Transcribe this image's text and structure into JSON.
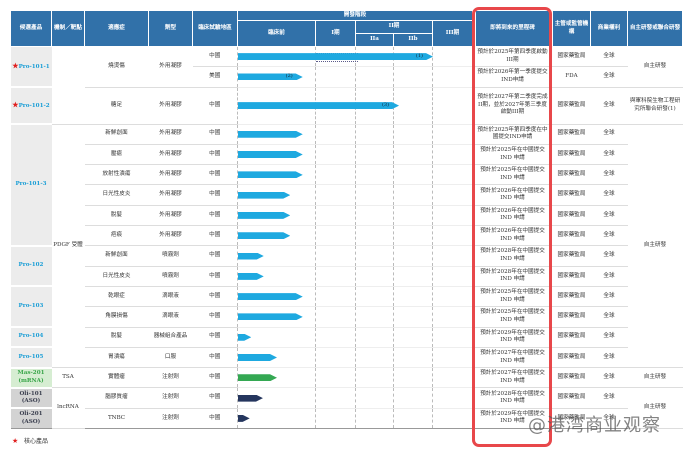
{
  "headers": {
    "drug": "候選產品",
    "mechanism": "機制／靶點",
    "indication": "適應症",
    "form": "劑型",
    "region": "臨床試驗地區",
    "stage": "開發階段",
    "preclinical": "臨床前",
    "phase1": "I期",
    "phase2": "II期",
    "phase2a": "IIa",
    "phase2b": "IIb",
    "phase3": "III期",
    "milestone": "即將到來的里程碑",
    "authority": "主管或監管機構",
    "rights": "商業權利",
    "dev_mode": "自主研發或聯合研發"
  },
  "colors": {
    "header": "#3171a9",
    "bar_blue": "#1ea9e0",
    "bar_green": "#34a853",
    "bar_navy": "#25365e",
    "highlight": "#e8474a",
    "star": "#e02020"
  },
  "stage_scale": [
    "臨床前",
    "I期",
    "IIa",
    "IIb",
    "III期"
  ],
  "drugs": [
    {
      "name": "Pro-101-1",
      "core": true,
      "rows": 2,
      "style": ""
    },
    {
      "name": "Pro-101-2",
      "core": true,
      "rows": 1,
      "style": ""
    },
    {
      "name": "Pro-101-3",
      "core": false,
      "rows": 6,
      "style": ""
    },
    {
      "name": "Pro-102",
      "core": false,
      "rows": 2,
      "style": ""
    },
    {
      "name": "Pro-103",
      "core": false,
      "rows": 2,
      "style": ""
    },
    {
      "name": "Pro-104",
      "core": false,
      "rows": 1,
      "style": ""
    },
    {
      "name": "Pro-105",
      "core": false,
      "rows": 1,
      "style": ""
    },
    {
      "name": "Mas-201 (mRNA)",
      "core": false,
      "rows": 1,
      "style": "green"
    },
    {
      "name": "Oli-101 (ASO)",
      "core": false,
      "rows": 1,
      "style": "gray"
    },
    {
      "name": "Oli-201 (ASO)",
      "core": false,
      "rows": 1,
      "style": "gray"
    }
  ],
  "mechanisms": [
    {
      "text": "",
      "rows": 3
    },
    {
      "text": "PDGF 受體",
      "rows": 12
    },
    {
      "text": "TSA",
      "rows": 1
    },
    {
      "text": "lncRNA",
      "rows": 2
    }
  ],
  "dev_modes": [
    {
      "text": "自主研發",
      "rows": 2
    },
    {
      "text": "與軍科院生物工程研究所聯合研發(1)",
      "rows": 1
    },
    {
      "text": "自主研發",
      "rows": 12
    },
    {
      "text": "自主研發",
      "rows": 1
    },
    {
      "text": "自主研發",
      "rows": 2
    }
  ],
  "indication_groups": [
    {
      "text": "燒燙傷",
      "rows": 2
    },
    {
      "text": "糖足",
      "rows": 1
    },
    {
      "text": "新鮮創面",
      "rows": 1
    },
    {
      "text": "壓瘡",
      "rows": 1
    },
    {
      "text": "放射性潰瘍",
      "rows": 1
    },
    {
      "text": "日光性皮炎",
      "rows": 1
    },
    {
      "text": "脫髮",
      "rows": 1
    },
    {
      "text": "疤痕",
      "rows": 1
    },
    {
      "text": "新鮮創面",
      "rows": 1
    },
    {
      "text": "日光性皮炎",
      "rows": 1
    },
    {
      "text": "乾眼症",
      "rows": 1
    },
    {
      "text": "角膜損傷",
      "rows": 1
    },
    {
      "text": "脫髮",
      "rows": 1
    },
    {
      "text": "胃潰瘍",
      "rows": 1
    },
    {
      "text": "實體瘤",
      "rows": 1
    },
    {
      "text": "腦膠質瘤",
      "rows": 1
    },
    {
      "text": "TNBC",
      "rows": 1
    }
  ],
  "form_groups": [
    {
      "text": "外用凝膠",
      "rows": 2
    },
    {
      "text": "外用凝膠",
      "rows": 1
    },
    {
      "text": "外用凝膠",
      "rows": 1
    },
    {
      "text": "外用凝膠",
      "rows": 1
    },
    {
      "text": "外用凝膠",
      "rows": 1
    },
    {
      "text": "外用凝膠",
      "rows": 1
    },
    {
      "text": "外用凝膠",
      "rows": 1
    },
    {
      "text": "外用凝膠",
      "rows": 1
    },
    {
      "text": "噴霧劑",
      "rows": 1
    },
    {
      "text": "噴霧劑",
      "rows": 1
    },
    {
      "text": "滴眼液",
      "rows": 1
    },
    {
      "text": "滴眼液",
      "rows": 1
    },
    {
      "text": "器械組合產品",
      "rows": 1
    },
    {
      "text": "口服",
      "rows": 1
    },
    {
      "text": "注射劑",
      "rows": 1
    },
    {
      "text": "注射劑",
      "rows": 1
    },
    {
      "text": "注射劑",
      "rows": 1
    }
  ],
  "rows": [
    {
      "region": "中國",
      "stage_reached": 4.0,
      "bar_label": "(1)",
      "color": "blue",
      "phase1_pending": true,
      "milestone": "預計於2025年第四季度啟動III期",
      "authority": "國家藥監局",
      "rights": "全球"
    },
    {
      "region": "美國",
      "stage_reached": 0.83,
      "bar_label": "(2)",
      "color": "blue",
      "milestone": "預計於2026年第一季度提交IND申請",
      "authority": "FDA",
      "rights": "全球"
    },
    {
      "region": "中國",
      "stage_reached": 3.13,
      "bar_label": "(3)",
      "color": "blue",
      "milestone": "預計於2027年第二季度完成II期，並於2027年第三季度啟動III期",
      "authority": "國家藥監局",
      "rights": "全球"
    },
    {
      "region": "中國",
      "stage_reached": 0.83,
      "bar_label": "",
      "color": "blue",
      "milestone": "預計於2025年第四季度在中國提交IND申請",
      "authority": "國家藥監局",
      "rights": "全球"
    },
    {
      "region": "中國",
      "stage_reached": 0.83,
      "bar_label": "",
      "color": "blue",
      "milestone": "預計於2025年在中國提交 IND 申請",
      "authority": "國家藥監局",
      "rights": "全球"
    },
    {
      "region": "中國",
      "stage_reached": 0.83,
      "bar_label": "",
      "color": "blue",
      "milestone": "預計於2025年在中國提交 IND 申請",
      "authority": "國家藥監局",
      "rights": "全球"
    },
    {
      "region": "中國",
      "stage_reached": 0.67,
      "bar_label": "",
      "color": "blue",
      "milestone": "預計於2026年在中國提交 IND 申請",
      "authority": "國家藥監局",
      "rights": "全球"
    },
    {
      "region": "中國",
      "stage_reached": 0.67,
      "bar_label": "",
      "color": "blue",
      "milestone": "預計於2026年在中國提交 IND 申請",
      "authority": "國家藥監局",
      "rights": "全球"
    },
    {
      "region": "中國",
      "stage_reached": 0.67,
      "bar_label": "",
      "color": "blue",
      "milestone": "預計於2026年在中國提交 IND 申請",
      "authority": "國家藥監局",
      "rights": "全球"
    },
    {
      "region": "中國",
      "stage_reached": 0.33,
      "bar_label": "",
      "color": "blue",
      "milestone": "預計於2028年在中國提交 IND 申請",
      "authority": "國家藥監局",
      "rights": "全球"
    },
    {
      "region": "中國",
      "stage_reached": 0.33,
      "bar_label": "",
      "color": "blue",
      "milestone": "預計於2028年在中國提交 IND 申請",
      "authority": "國家藥監局",
      "rights": "全球"
    },
    {
      "region": "中國",
      "stage_reached": 0.83,
      "bar_label": "",
      "color": "blue",
      "milestone": "預計於2025年在中國提交 IND 申請",
      "authority": "國家藥監局",
      "rights": "全球"
    },
    {
      "region": "中國",
      "stage_reached": 0.83,
      "bar_label": "",
      "color": "blue",
      "milestone": "預計於2025年在中國提交 IND 申請",
      "authority": "國家藥監局",
      "rights": "全球"
    },
    {
      "region": "中國",
      "stage_reached": 0.17,
      "bar_label": "",
      "color": "blue",
      "milestone": "預計於2029年在中國提交 IND 申請",
      "authority": "國家藥監局",
      "rights": "全球"
    },
    {
      "region": "中國",
      "stage_reached": 0.5,
      "bar_label": "",
      "color": "blue",
      "milestone": "預計於2027年在中國提交 IND 申請",
      "authority": "國家藥監局",
      "rights": "全球"
    },
    {
      "region": "中國",
      "stage_reached": 0.5,
      "bar_label": "",
      "color": "green",
      "milestone": "預計於2027年在中國提交 IND 申請",
      "authority": "國家藥監局",
      "rights": "全球"
    },
    {
      "region": "中國",
      "stage_reached": 0.32,
      "bar_label": "",
      "color": "navy",
      "milestone": "預計於2028年在中國提交 IND 申請",
      "authority": "國家藥監局",
      "rights": "全球"
    },
    {
      "region": "中國",
      "stage_reached": 0.15,
      "bar_label": "",
      "color": "navy",
      "milestone": "預計於2029年在中國提交 IND 申請",
      "authority": "國家藥監局",
      "rights": "全球"
    }
  ],
  "legend": {
    "label": "核心產品"
  },
  "watermark": "@港湾商业观察"
}
